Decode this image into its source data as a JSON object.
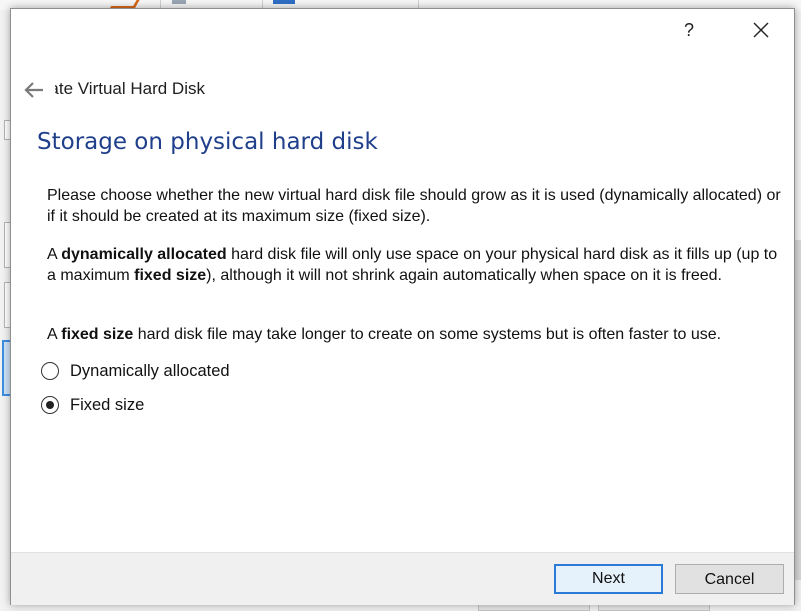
{
  "window": {
    "help_label": "?",
    "close_label": "close"
  },
  "wizard": {
    "title": "Create Virtual Hard Disk",
    "page_heading": "Storage on physical hard disk"
  },
  "content": {
    "p1": "Please choose whether the new virtual hard disk file should grow as it is used (dynamically allocated) or if it should be created at its maximum size (fixed size).",
    "p2_a": "A ",
    "p2_bold1": "dynamically allocated",
    "p2_b": " hard disk file will only use space on your physical hard disk as it fills up (up to a maximum ",
    "p2_bold2": "fixed size",
    "p2_c": "), although it will not shrink again automatically when space on it is freed.",
    "p3_a": "A ",
    "p3_bold": "fixed size",
    "p3_b": " hard disk file may take longer to create on some systems but is often faster to use."
  },
  "options": [
    {
      "label": "Dynamically allocated",
      "checked": false
    },
    {
      "label": "Fixed size",
      "checked": true
    }
  ],
  "footer": {
    "next_label": "Next",
    "cancel_label": "Cancel"
  },
  "icons": {
    "back": "back-arrow-icon",
    "close": "close-icon"
  },
  "colors": {
    "heading": "#1f3f8a",
    "default_button_border": "#2a7ad6"
  }
}
